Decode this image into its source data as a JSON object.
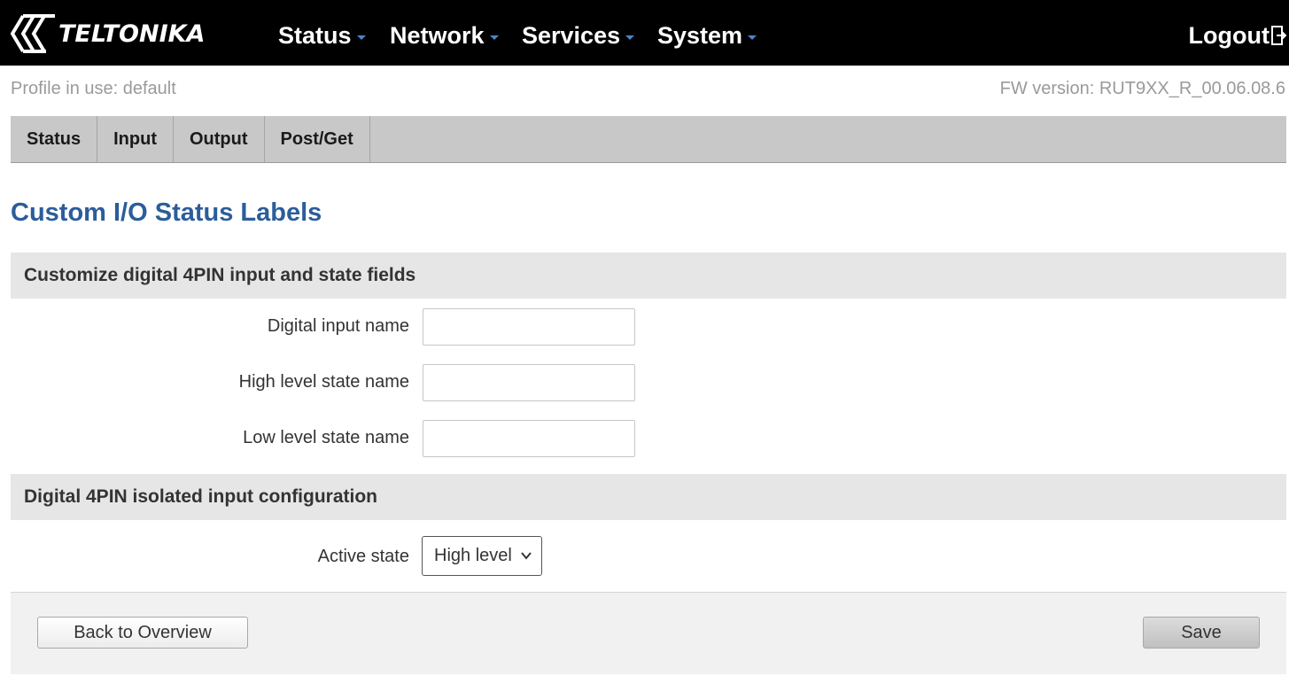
{
  "brand": {
    "logo_text": "TELTONIKA"
  },
  "nav": {
    "items": [
      {
        "label": "Status"
      },
      {
        "label": "Network"
      },
      {
        "label": "Services"
      },
      {
        "label": "System"
      }
    ],
    "logout_label": "Logout"
  },
  "info": {
    "profile": "Profile in use: default",
    "firmware": "FW version: RUT9XX_R_00.06.08.6"
  },
  "tabs": [
    {
      "label": "Status"
    },
    {
      "label": "Input"
    },
    {
      "label": "Output"
    },
    {
      "label": "Post/Get"
    }
  ],
  "page": {
    "title": "Custom I/O Status Labels"
  },
  "section1": {
    "title": "Customize digital 4PIN input and state fields",
    "fields": [
      {
        "label": "Digital input name",
        "value": ""
      },
      {
        "label": "High level state name",
        "value": ""
      },
      {
        "label": "Low level state name",
        "value": ""
      }
    ]
  },
  "section2": {
    "title": "Digital 4PIN isolated input configuration",
    "active_state": {
      "label": "Active state",
      "selected": "High level"
    }
  },
  "footer": {
    "back_label": "Back to Overview",
    "save_label": "Save"
  },
  "colors": {
    "accent_title": "#2b5d9b",
    "nav_caret": "#4a86c5",
    "topbar": "#000000",
    "tabbar": "#c8c8c8",
    "section_bg": "#e6e6e6"
  },
  "icons": {
    "logo": "teltonika-diamond-logo",
    "nav_dropdown": "caret-down-icon",
    "logout": "logout-icon",
    "select": "chevron-down-icon"
  }
}
